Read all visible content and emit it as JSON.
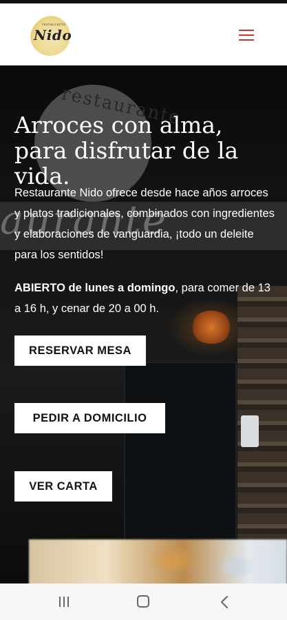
{
  "header": {
    "logo_text": "Nido",
    "logo_subtext": "restaurante"
  },
  "hero": {
    "sign_text": "restaurante",
    "window_text": "aurante",
    "title": "Arroces con alma, para disfrutar de la vida.",
    "description": "Restaurante Nido ofrece desde hace años arroces y platos tradicionales, combinados con ingredientes y elaboraciones de vanguardia, ¡todo un deleite para los sentidos!",
    "hours_bold": "ABIERTO de lunes a domingo",
    "hours_rest": ", para comer de 13 a 16 h, y cenar de 20 a 00 h.",
    "buttons": {
      "reservar": "RESERVAR MESA",
      "pedir": "PEDIR A DOMICILIO",
      "carta": "VER CARTA"
    }
  },
  "colors": {
    "accent": "#d0312d",
    "hero_bg": "#111111",
    "button_bg": "#ffffff"
  },
  "icons": {
    "menu": "hamburger-icon",
    "recent": "recent-apps-icon",
    "home": "home-icon",
    "back": "back-icon"
  }
}
